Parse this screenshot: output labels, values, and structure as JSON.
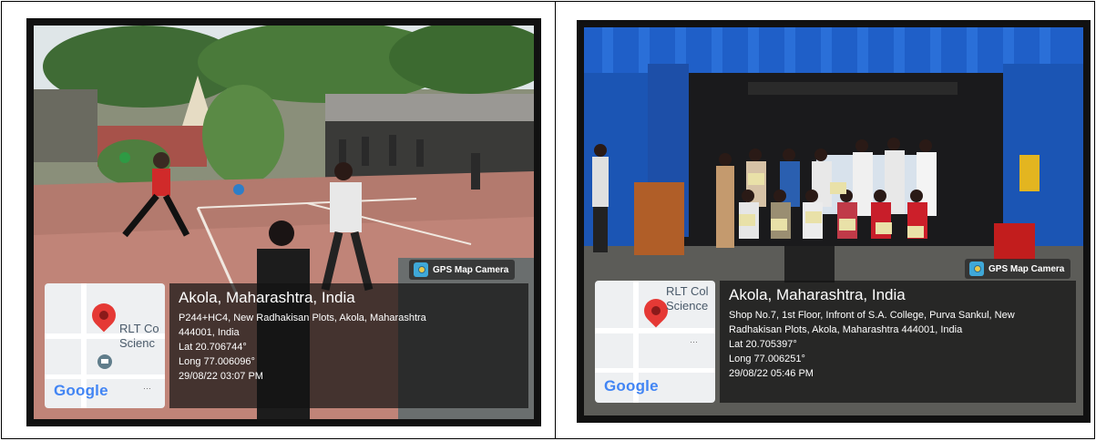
{
  "photos": [
    {
      "gps_tag": "GPS Map Camera",
      "map_label": "RLT Co\nScienc",
      "map_logo": "Google",
      "city": "Akola, Maharashtra, India",
      "address_1": "P244+HC4, New Radhakisan Plots, Akola, Maharashtra",
      "address_2": "444001, India",
      "lat": "Lat 20.706744°",
      "long": "Long 77.006096°",
      "datetime": "29/08/22 03:07 PM"
    },
    {
      "gps_tag": "GPS Map Camera",
      "map_label": "RLT Col\nScience",
      "map_logo": "Google",
      "city": "Akola, Maharashtra, India",
      "address_1": "Shop No.7, 1st Floor, Infront of S.A. College, Purva Sankul, New",
      "address_2": "Radhakisan Plots, Akola, Maharashtra 444001, India",
      "lat": "Lat 20.705397°",
      "long": "Long 77.006251°",
      "datetime": "29/08/22 05:46 PM"
    }
  ],
  "colors": {
    "google_blue": "#4285F4",
    "google_red": "#EA4335",
    "google_yellow": "#FBBC05",
    "google_green": "#34A853",
    "pin": "#e53935"
  }
}
